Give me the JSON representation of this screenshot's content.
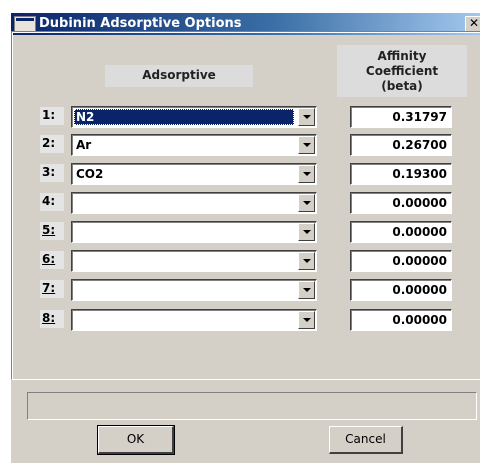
{
  "window": {
    "title": "Dubinin Adsorptive Options",
    "close_glyph": "✕"
  },
  "headers": {
    "adsorptive": "Adsorptive",
    "affinity": "Affinity\nCoefficient\n(beta)"
  },
  "rows": [
    {
      "label": "1:",
      "adsorptive": "N2",
      "coefficient": "0.31797"
    },
    {
      "label": "2:",
      "adsorptive": "Ar",
      "coefficient": "0.26700"
    },
    {
      "label": "3:",
      "adsorptive": "CO2",
      "coefficient": "0.19300"
    },
    {
      "label": "4:",
      "adsorptive": "",
      "coefficient": "0.00000"
    },
    {
      "label": "5:",
      "adsorptive": "",
      "coefficient": "0.00000"
    },
    {
      "label": "6:",
      "adsorptive": "",
      "coefficient": "0.00000"
    },
    {
      "label": "7:",
      "adsorptive": "",
      "coefficient": "0.00000"
    },
    {
      "label": "8:",
      "adsorptive": "",
      "coefficient": "0.00000"
    }
  ],
  "buttons": {
    "ok": "OK",
    "cancel": "Cancel"
  },
  "status_text": ""
}
